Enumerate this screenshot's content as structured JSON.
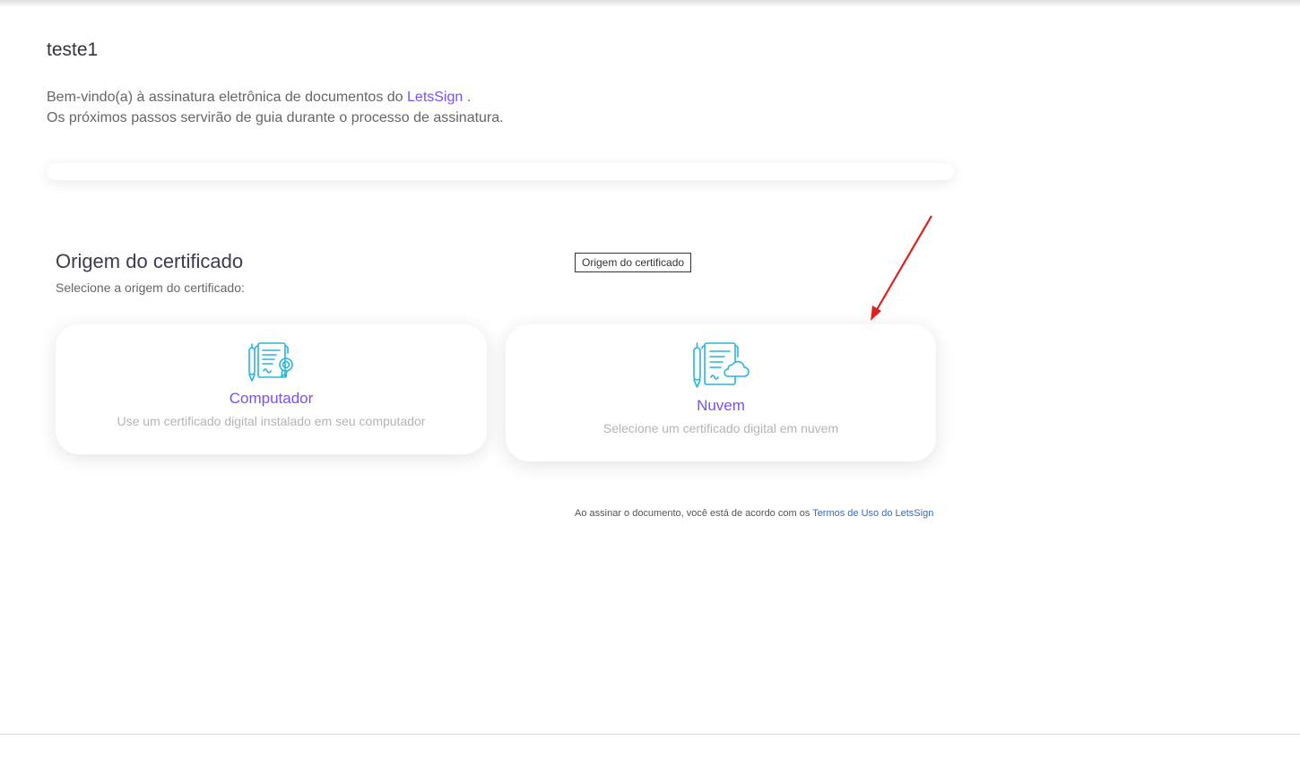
{
  "document": {
    "title": "teste1"
  },
  "welcome": {
    "line1_prefix": "Bem-vindo(a) à assinatura eletrônica de documentos do",
    "brand": "LetsSign",
    "line1_suffix": ".",
    "line2": "Os próximos passos servirão de guia durante o processo de assinatura."
  },
  "progress": {
    "value": 0
  },
  "certificate_origin": {
    "title": "Origem do certificado",
    "subtitle": "Selecione a origem do certificado:",
    "tooltip": "Origem do certificado",
    "options": [
      {
        "title": "Computador",
        "description": "Use um certificado digital instalado em seu computador",
        "icon": "certificate-seal-icon"
      },
      {
        "title": "Nuvem",
        "description": "Selecione um certificado digital em nuvem",
        "icon": "certificate-cloud-icon"
      }
    ]
  },
  "footer": {
    "terms_prefix": "Ao assinar o documento, você está de acordo com os",
    "terms_link": "Termos de Uso do LetsSign"
  },
  "colors": {
    "accent": "#7b4dff",
    "icon": "#29b6d8",
    "link": "#3d6bb5",
    "annotation": "#e02020"
  }
}
